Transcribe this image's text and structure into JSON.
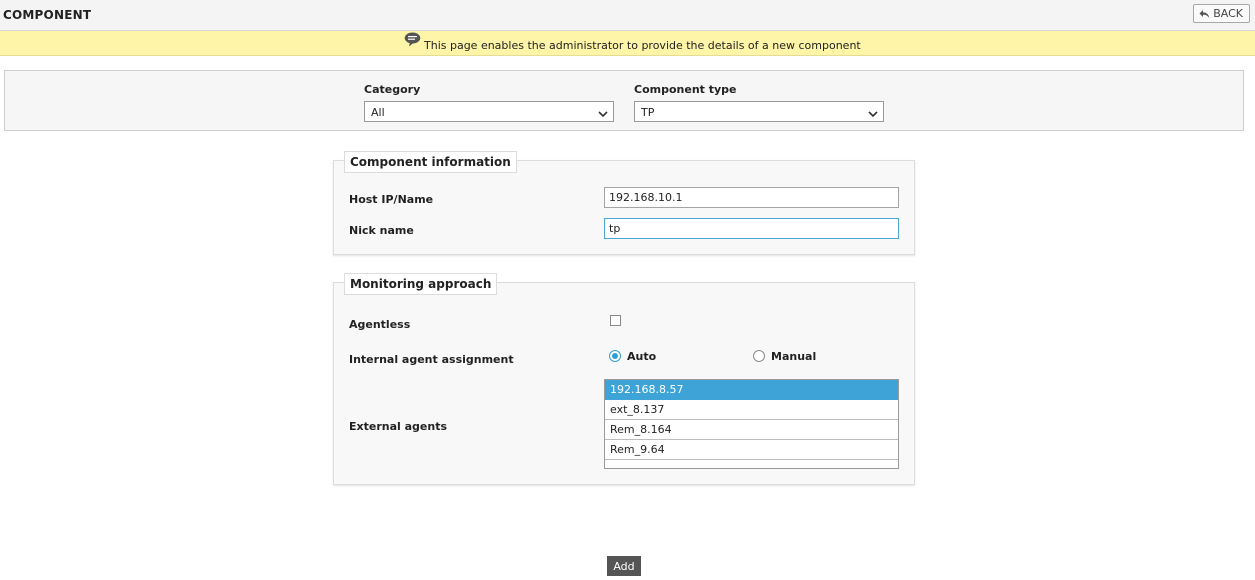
{
  "header": {
    "title": "COMPONENT",
    "back_label": "BACK"
  },
  "infobar": {
    "message": "This page enables the administrator to provide the details of a new component"
  },
  "filters": {
    "category": {
      "label": "Category",
      "value": "All"
    },
    "component_type": {
      "label": "Component type",
      "value": "TP"
    }
  },
  "component_information": {
    "legend": "Component information",
    "host": {
      "label": "Host IP/Name",
      "value": "192.168.10.1"
    },
    "nick": {
      "label": "Nick name",
      "value": "tp"
    }
  },
  "monitoring_approach": {
    "legend": "Monitoring approach",
    "agentless": {
      "label": "Agentless",
      "checked": false
    },
    "internal_agent": {
      "label": "Internal agent assignment",
      "options": [
        "Auto",
        "Manual"
      ],
      "selected": "Auto"
    },
    "external_agents": {
      "label": "External agents",
      "items": [
        "192.168.8.57",
        "ext_8.137",
        "Rem_8.164",
        "Rem_9.64"
      ],
      "selected_index": 0
    }
  },
  "actions": {
    "add_label": "Add"
  },
  "colors": {
    "accent": "#3ea4d7",
    "infobar": "#fff5a8",
    "button_dark": "#555555"
  }
}
